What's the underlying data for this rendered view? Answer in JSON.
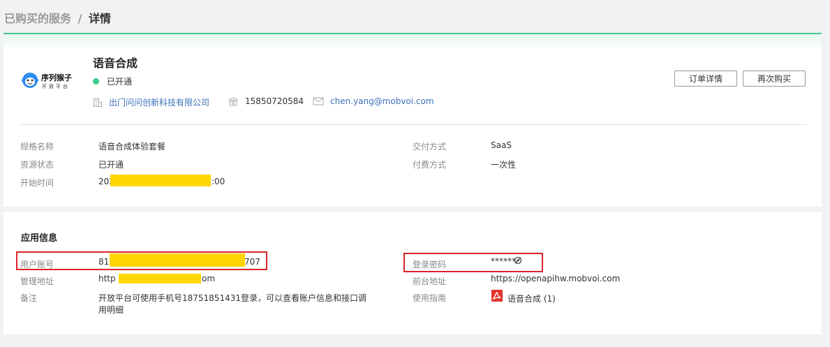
{
  "breadcrumb": {
    "parent": "已购买的服务",
    "separator": "/",
    "current": "详情"
  },
  "logo": {
    "name": "序列猴子",
    "sub": "开放平台"
  },
  "service": {
    "title": "语音合成",
    "status": "已开通",
    "company": "出门问问创新科技有限公司",
    "phone": "15850720584",
    "email": "chen.yang@mobvoi.com"
  },
  "actions": {
    "order_detail": "订单详情",
    "buy_again": "再次购买"
  },
  "details": {
    "spec_label": "规格名称",
    "spec_value": "语音合成体验套餐",
    "resource_label": "资源状态",
    "resource_value": "已开通",
    "start_label": "开始时间",
    "start_value_prefix": "202",
    "start_value_suffix": ":00",
    "delivery_label": "交付方式",
    "delivery_value": "SaaS",
    "payment_label": "付费方式",
    "payment_value": "一次性"
  },
  "app_info": {
    "title": "应用信息",
    "account_label": "用户账号",
    "account_prefix": "81(",
    "account_suffix": "707",
    "admin_label": "管理地址",
    "admin_prefix": "http",
    "admin_suffix": "om",
    "note_label": "备注",
    "note_value_line1": "开放平台可使用手机号18751851431登录，可以查看账户信息和接口调",
    "note_value_line2": "用明细",
    "password_label": "登录密码",
    "password_value": "******",
    "frontend_label": "前台地址",
    "frontend_value": "https://openapihw.mobvoi.com",
    "guide_label": "使用指南",
    "guide_value": "语音合成 (1)"
  },
  "colors": {
    "accent_green": "#47c58e",
    "status_green": "#3fcf8e",
    "link_blue": "#3a6fb8",
    "highlight_red": "#d9232b",
    "mask_yellow": "#ffd700"
  }
}
